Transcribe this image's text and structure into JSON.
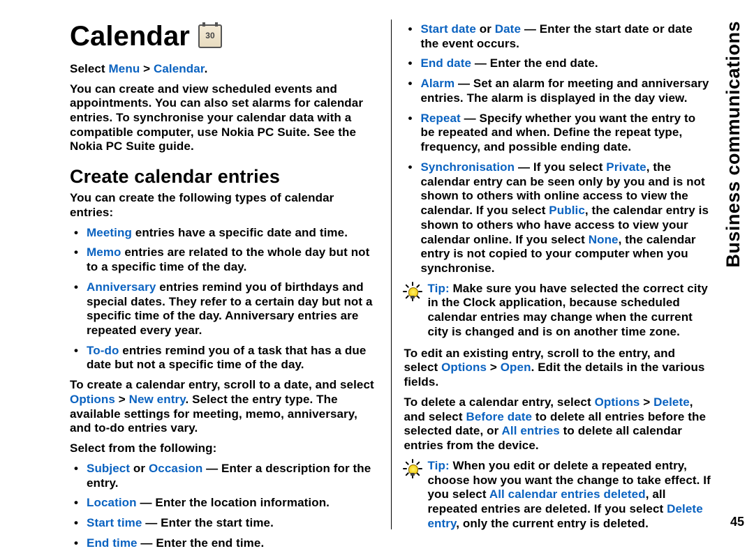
{
  "sideTab": "Business communications",
  "pageNumber": "45",
  "title": "Calendar",
  "nav": {
    "select": "Select ",
    "menu": "Menu",
    "arrow": " > ",
    "calendar": "Calendar",
    "dot": "."
  },
  "intro": "You can create and view scheduled events and appointments. You can also set alarms for calendar entries. To synchronise your calendar data with a compatible computer, use Nokia PC Suite. See the Nokia PC Suite guide.",
  "h2": "Create calendar entries",
  "entriesLead": "You can create the following types of calendar entries:",
  "entryTypes": [
    {
      "kw": "Meeting",
      "rest": " entries have a specific date and time."
    },
    {
      "kw": "Memo",
      "rest": " entries are related to the whole day but not to a specific time of the day."
    },
    {
      "kw": "Anniversary",
      "rest": " entries remind you of birthdays and special dates. They refer to a certain day but not a specific time of the day. Anniversary entries are repeated every year."
    },
    {
      "kw": "To-do",
      "rest": " entries remind you of a task that has a due date but not a specific time of the day."
    }
  ],
  "createEntry": {
    "pre": "To create a calendar entry, scroll to a date, and select ",
    "kw1": "Options",
    "arrow": " > ",
    "kw2": "New entry",
    "post": ". Select the entry type. The available settings for meeting, memo, anniversary, and to-do entries vary."
  },
  "selectFrom": "Select from the following:",
  "fieldsCol1": [
    {
      "parts": [
        {
          "kw": "Subject"
        },
        {
          "t": " or "
        },
        {
          "kw": "Occasion"
        },
        {
          "t": " — Enter a description for the entry."
        }
      ]
    },
    {
      "parts": [
        {
          "kw": "Location"
        },
        {
          "t": " — Enter the location information."
        }
      ]
    },
    {
      "parts": [
        {
          "kw": "Start time"
        },
        {
          "t": " — Enter the start time."
        }
      ]
    },
    {
      "parts": [
        {
          "kw": "End time"
        },
        {
          "t": " — Enter the end time."
        }
      ]
    }
  ],
  "fieldsCol2": [
    {
      "parts": [
        {
          "kw": "Start date"
        },
        {
          "t": " or "
        },
        {
          "kw": "Date"
        },
        {
          "t": " — Enter the start date or date the event occurs."
        }
      ]
    },
    {
      "parts": [
        {
          "kw": "End date"
        },
        {
          "t": " — Enter the end date."
        }
      ]
    },
    {
      "parts": [
        {
          "kw": "Alarm"
        },
        {
          "t": " — Set an alarm for meeting and anniversary entries. The alarm is displayed in the day view."
        }
      ]
    },
    {
      "parts": [
        {
          "kw": "Repeat"
        },
        {
          "t": " — Specify whether you want the entry to be repeated and when. Define the repeat type, frequency, and possible ending date."
        }
      ]
    },
    {
      "parts": [
        {
          "kw": "Synchronisation"
        },
        {
          "t": " — If you select "
        },
        {
          "kw": "Private"
        },
        {
          "t": ", the calendar entry can be seen only by you and is not shown to others with online access to view the calendar. If you select "
        },
        {
          "kw": "Public"
        },
        {
          "t": ", the calendar entry is shown to others who have access to view your calendar online. If you select "
        },
        {
          "kw": "None"
        },
        {
          "t": ", the calendar entry is not copied to your computer when you synchronise."
        }
      ]
    }
  ],
  "tip1": {
    "label": "Tip:",
    "body": " Make sure you have selected the correct city in the Clock application, because scheduled calendar entries may change when the current city is changed and is on another time zone."
  },
  "edit": {
    "pre": "To edit an existing entry, scroll to the entry, and select ",
    "kw1": "Options",
    "arrow": " > ",
    "kw2": "Open",
    "post": ". Edit the details in the various fields."
  },
  "delete": {
    "pre": "To delete a calendar entry, select ",
    "kw1": "Options",
    "arrow": " > ",
    "kw2": "Delete",
    "mid1": ", and select ",
    "kw3": "Before date",
    "mid2": " to delete all entries before the selected date, or ",
    "kw4": "All entries",
    "post": " to delete all calendar entries from the device."
  },
  "tip2": {
    "label": "Tip:",
    "pre": "  When you edit or delete a repeated entry, choose how you want the change to take effect. If you select ",
    "kw1": "All calendar entries deleted",
    "mid": ", all repeated entries are deleted. If you select ",
    "kw2": "Delete entry",
    "post": ", only the current entry is deleted."
  }
}
